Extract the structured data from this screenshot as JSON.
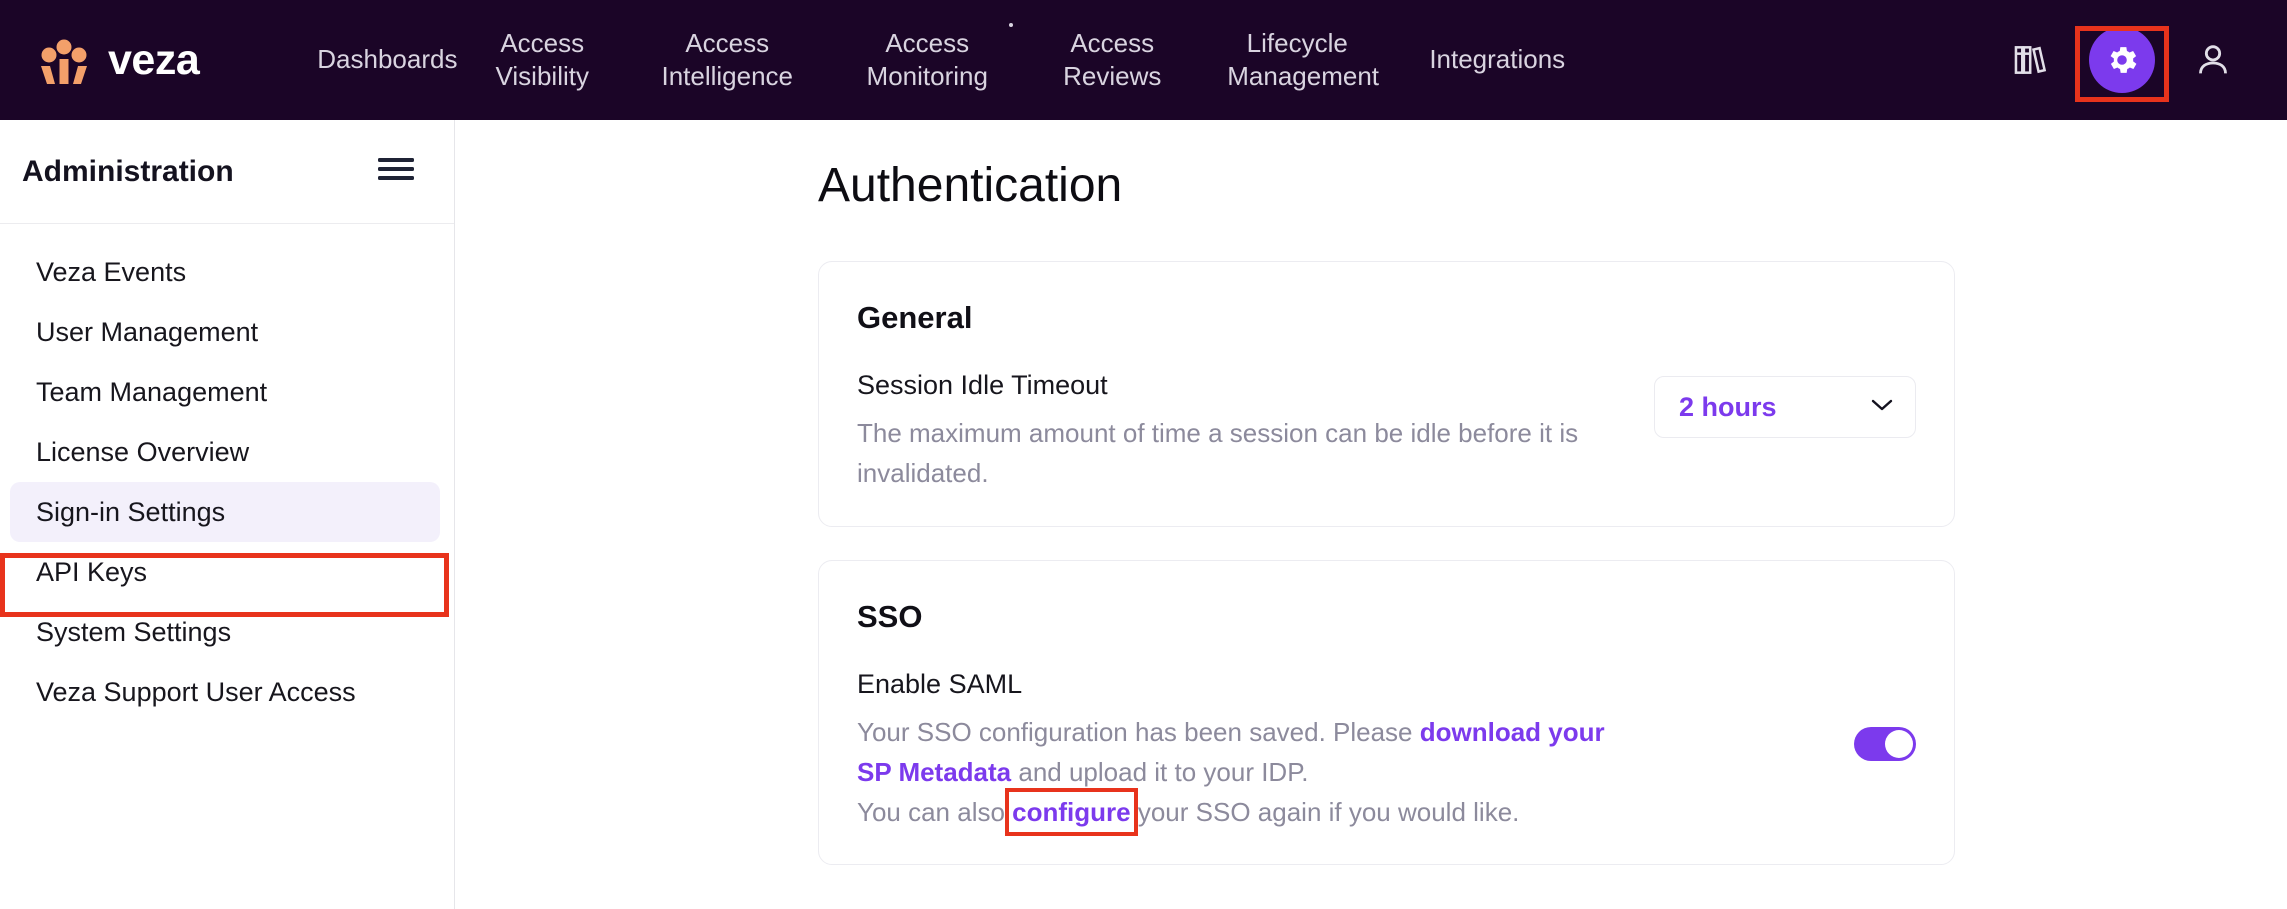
{
  "colors": {
    "nav_bg": "#1b0527",
    "brand_orange": "#f3a06a",
    "accent_purple": "#7c3aed",
    "highlight_red": "#e8331c",
    "active_item_bg": "#f3f0fb",
    "muted_text": "#8c8a9c"
  },
  "topnav": {
    "brand_name": "veza",
    "logo_icon": "veza-people-logo-icon",
    "items": [
      {
        "label": "Dashboards",
        "has_dot": false
      },
      {
        "label": "Access\nVisibility",
        "has_dot": false
      },
      {
        "label": "Access\nIntelligence",
        "has_dot": false
      },
      {
        "label": "Access\nMonitoring",
        "has_dot": true
      },
      {
        "label": "Access\nReviews",
        "has_dot": false
      },
      {
        "label": "Lifecycle\nManagement",
        "has_dot": false
      },
      {
        "label": "Integrations",
        "has_dot": false
      }
    ],
    "right_icons": [
      {
        "name": "library-books-icon"
      },
      {
        "name": "gear-icon",
        "highlighted": true
      },
      {
        "name": "user-account-icon"
      }
    ]
  },
  "sidebar": {
    "title": "Administration",
    "menu_icon": "hamburger-menu-icon",
    "items": [
      {
        "label": "Veza Events",
        "active": false
      },
      {
        "label": "User Management",
        "active": false
      },
      {
        "label": "Team Management",
        "active": false
      },
      {
        "label": "License Overview",
        "active": false
      },
      {
        "label": "Sign-in Settings",
        "active": true,
        "highlighted": true
      },
      {
        "label": "API Keys",
        "active": false
      },
      {
        "label": "System Settings",
        "active": false
      },
      {
        "label": "Veza Support User Access",
        "active": false
      }
    ]
  },
  "main": {
    "page_title": "Authentication",
    "general_card": {
      "title": "General",
      "field_label": "Session Idle Timeout",
      "field_desc": "The maximum amount of time a session can be idle before it is invalidated.",
      "select_value": "2 hours",
      "chevron_icon": "chevron-down-icon"
    },
    "sso_card": {
      "title": "SSO",
      "field_label": "Enable SAML",
      "desc_part_1": "Your SSO configuration has been saved. Please ",
      "link_1": "download your SP Metadata",
      "desc_part_2": " and upload it to your IDP.",
      "desc_part_3": "You can also ",
      "link_2": "configure",
      "desc_part_4": " your SSO again if you would like.",
      "toggle_state": "on"
    }
  }
}
